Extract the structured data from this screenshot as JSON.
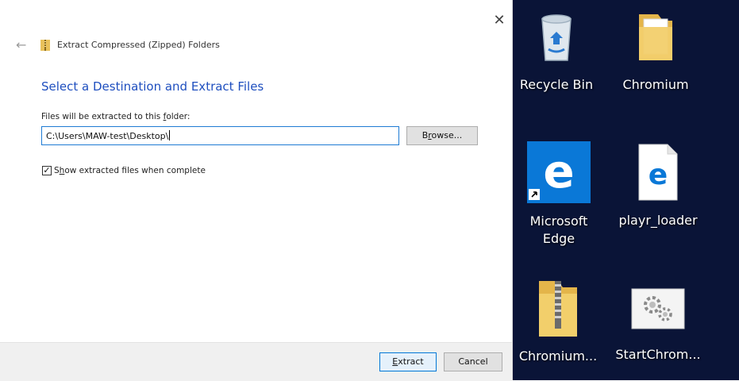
{
  "dialog": {
    "title": "Extract Compressed (Zipped) Folders",
    "heading": "Select a Destination and Extract Files",
    "path_label_prefix": "Files will be extracted to this ",
    "path_label_hotkey": "f",
    "path_label_suffix": "older:",
    "path_value": "C:\\Users\\MAW-test\\Desktop\\",
    "browse_label_prefix": "B",
    "browse_label_hotkey": "r",
    "browse_label_suffix": "owse...",
    "checkbox_label_prefix": "S",
    "checkbox_label_hotkey": "h",
    "checkbox_label_suffix": "ow extracted files when complete",
    "checkbox_checked": true,
    "extract_label_hotkey": "E",
    "extract_label_suffix": "xtract",
    "cancel_label": "Cancel",
    "close_glyph": "✕",
    "back_glyph": "←"
  },
  "desktop": {
    "background": "#0a1437",
    "icons": [
      {
        "label": "Recycle Bin",
        "icon": "recycle-bin-icon"
      },
      {
        "label": "Chromium",
        "icon": "folder-icon"
      },
      {
        "label_line1": "Microsoft",
        "label_line2": "Edge",
        "icon": "edge-shortcut-icon"
      },
      {
        "label": "playr_loader",
        "icon": "edge-file-icon"
      },
      {
        "label": "Chromium...",
        "icon": "zip-folder-icon"
      },
      {
        "label": "StartChrom...",
        "icon": "settings-file-icon"
      }
    ]
  },
  "colors": {
    "heading_blue": "#1f4fbf",
    "edge_blue": "#0a78d7",
    "folder_yellow": "#f2cf6b"
  }
}
